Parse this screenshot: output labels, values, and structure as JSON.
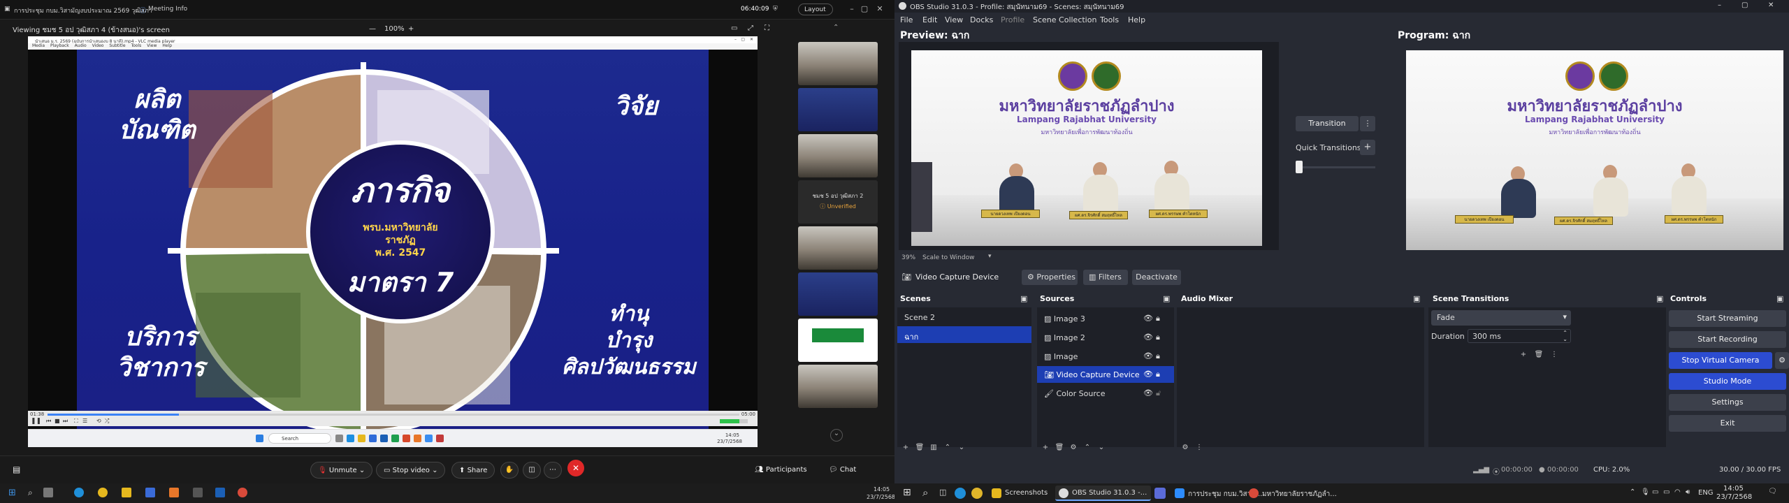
{
  "zoom": {
    "window_title": "การประชุม กบม.วิสามัญงบประมาณ 2569 วุฒิสภา",
    "app_name": "Meeting Info",
    "timer": "06:40:09",
    "layout_label": "Layout",
    "viewing_label": "Viewing ชมช 5 อป วุฒิสภา 4 (ข้างสนอ)'s screen",
    "zoom_minus": "—",
    "zoom_level": "100%",
    "zoom_plus": "+",
    "participant_tile_name": "ชมช 5 อป วุฒิสภา 2",
    "participant_tile_status": "Unverified",
    "toolbar": {
      "unmute": "Unmute",
      "stop_video": "Stop video",
      "share": "Share",
      "participants": "Participants",
      "chat": "Chat"
    },
    "taskbar_time": "14:05",
    "taskbar_date": "23/7/2568"
  },
  "vlc": {
    "title": "นำเสนอ ม.ร. 2569 (ฉบับการนำเสนองบ 8 นาที).mp4 - VLC media player",
    "menu": [
      "Media",
      "Playback",
      "Audio",
      "Video",
      "Subtitle",
      "Tools",
      "View",
      "Help"
    ],
    "time_elapsed": "01:38",
    "time_total": "05:00",
    "progress": 0.19
  },
  "slide": {
    "top_left": "ผลิต\nบัณฑิต",
    "top_right": "วิจัย",
    "bottom_left": "บริการ\nวิชาการ",
    "bottom_right": "ทำนุ\nบำรุง\nศิลปวัฒนธรรม",
    "center_title": "ภารกิจ",
    "center_sub1": "พรบ.มหาวิทยาลัย",
    "center_sub2": "ราชภัฏ",
    "center_sub3": "พ.ศ. 2547",
    "center_num": "มาตรา 7"
  },
  "inner_taskbar": {
    "search_placeholder": "Search",
    "time": "14:05",
    "date": "23/7/2568"
  },
  "obs": {
    "title": "OBS Studio 31.0.3 - Profile: สมุนัทนาม69 - Scenes: สมุนัทนาม69",
    "menu": [
      "File",
      "Edit",
      "View",
      "Docks",
      "Profile",
      "Scene Collection",
      "Tools",
      "Help"
    ],
    "preview_label": "Preview: ฉาก",
    "program_label": "Program: ฉาก",
    "transition_label": "Transition",
    "quick_transitions_label": "Quick Transitions",
    "zoom_percent": "39%",
    "scale_label": "Scale to Window",
    "source_name": "Video Capture Device",
    "properties_label": "Properties",
    "filters_label": "Filters",
    "deactivate_label": "Deactivate",
    "feed": {
      "uni_th": "มหาวิทยาลัยราชภัฏลำปาง",
      "uni_en": "Lampang Rajabhat University",
      "uni_sub": "มหาวิทยาลัยเพื่อการพัฒนาท้องถิ่น",
      "plates": [
        "นายดวงเทพ เปียงดอน",
        "ผศ.ดร.จิรศักดิ์ สมฤทธิ์ไหล",
        "ผศ.ดร.พรรษพ คำโตหนัก"
      ]
    },
    "panels": {
      "scenes_title": "Scenes",
      "sources_title": "Sources",
      "audio_title": "Audio Mixer",
      "transitions_title": "Scene Transitions",
      "controls_title": "Controls"
    },
    "scenes": [
      "Scene 2",
      "ฉาก"
    ],
    "sources": [
      "Image 3",
      "Image 2",
      "Image",
      "Video Capture Device",
      "Color Source"
    ],
    "transition_type": "Fade",
    "duration_label": "Duration",
    "duration_value": "300 ms",
    "controls": {
      "start_streaming": "Start Streaming",
      "start_recording": "Start Recording",
      "stop_virtual_camera": "Stop Virtual Camera",
      "studio_mode": "Studio Mode",
      "settings": "Settings",
      "exit": "Exit"
    },
    "status": {
      "stream_time": "00:00:00",
      "rec_time": "00:00:00",
      "cpu": "CPU: 2.0%",
      "fps": "30.00 / 30.00 FPS"
    }
  },
  "taskbar_right": {
    "apps": [
      "Screenshots",
      "OBS Studio 31.0.3 -...",
      "การประชุม กบม.วิสามั...",
      "มหาวิทยาลัยราชภัฏลำ..."
    ],
    "lang": "ENG",
    "time": "14:05",
    "date": "23/7/2568"
  },
  "colors": {
    "obs_bg": "#272a33",
    "obs_selected": "#1d3eb3",
    "obs_accent_button": "#2c4cd1",
    "slide_blue": "#1d2a8f",
    "zoom_leave": "#e02828"
  }
}
